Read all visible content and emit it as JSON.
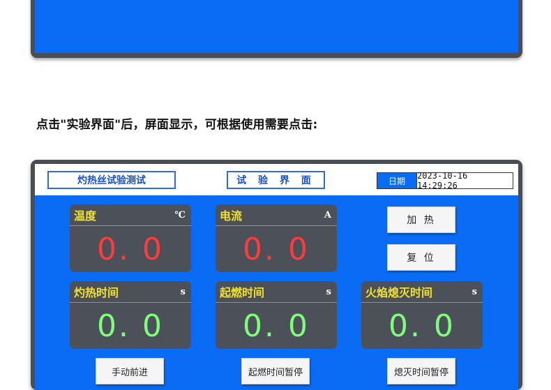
{
  "instruction": "点击\"实验界面\"后，屏面显示，可根据使用需要点击:",
  "header": {
    "left_title": "灼热丝试验测试",
    "center_title": "试 验 界 面",
    "date_label": "日期",
    "date_value": "2023-10-16 14:29:26"
  },
  "panels": {
    "temperature": {
      "title": "温度",
      "unit": "℃",
      "value": "0. 0"
    },
    "current": {
      "title": "电流",
      "unit": "A",
      "value": "0. 0"
    },
    "burn_time": {
      "title": "灼热时间",
      "unit": "s",
      "value": "0. 0"
    },
    "ignition_time": {
      "title": "起燃时间",
      "unit": "s",
      "value": "0. 0"
    },
    "extinguish_time": {
      "title": "火焰熄灭时间",
      "unit": "s",
      "value": "0. 0"
    }
  },
  "buttons": {
    "heat": "加 热",
    "reset": "复 位",
    "manual_forward": "手动前进",
    "ignition_pause": "起燃时间暂停",
    "extinguish_pause": "熄灭时间暂停"
  },
  "colors": {
    "screen_blue": "#0a6cf4",
    "panel_gray": "#4c5058",
    "title_yellow": "#f2e32a",
    "value_red": "#ff3b3b",
    "value_green": "#7dff7a"
  }
}
